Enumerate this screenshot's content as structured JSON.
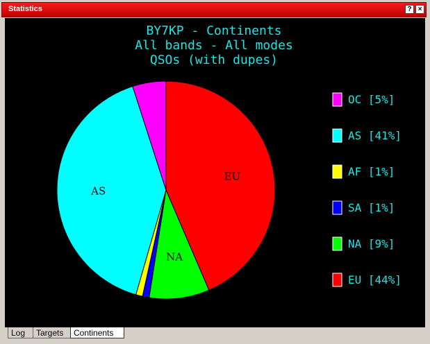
{
  "window": {
    "title": "Statistics",
    "help_label": "?",
    "close_label": "×"
  },
  "tabs": [
    {
      "label": "Log",
      "active": false
    },
    {
      "label": "Targets",
      "active": false
    },
    {
      "label": "Continents",
      "active": true
    }
  ],
  "colors": {
    "title_text": "#19e6e6",
    "background": "#000000",
    "titlebar": "#e01010"
  },
  "chart_data": {
    "type": "pie",
    "title_lines": [
      "BY7KP - Continents",
      "All bands - All modes",
      "QSOs (with dupes)"
    ],
    "slices": [
      {
        "label": "EU",
        "percent": 44,
        "legend": "EU [44%]",
        "color": "#ff0000"
      },
      {
        "label": "NA",
        "percent": 9,
        "legend": "NA [9%]",
        "color": "#00ff00"
      },
      {
        "label": "SA",
        "percent": 1,
        "legend": "SA [1%]",
        "color": "#0000ff"
      },
      {
        "label": "AF",
        "percent": 1,
        "legend": "AF [1%]",
        "color": "#ffff00"
      },
      {
        "label": "AS",
        "percent": 41,
        "legend": "AS [41%]",
        "color": "#00ffff"
      },
      {
        "label": "OC",
        "percent": 5,
        "legend": "OC [5%]",
        "color": "#ff00ff"
      }
    ],
    "slice_order_note": [
      "EU",
      "NA",
      "SA",
      "AF",
      "AS",
      "OC"
    ],
    "legend_order": [
      "OC",
      "AS",
      "AF",
      "SA",
      "NA",
      "EU"
    ],
    "legend_placement": "right"
  }
}
